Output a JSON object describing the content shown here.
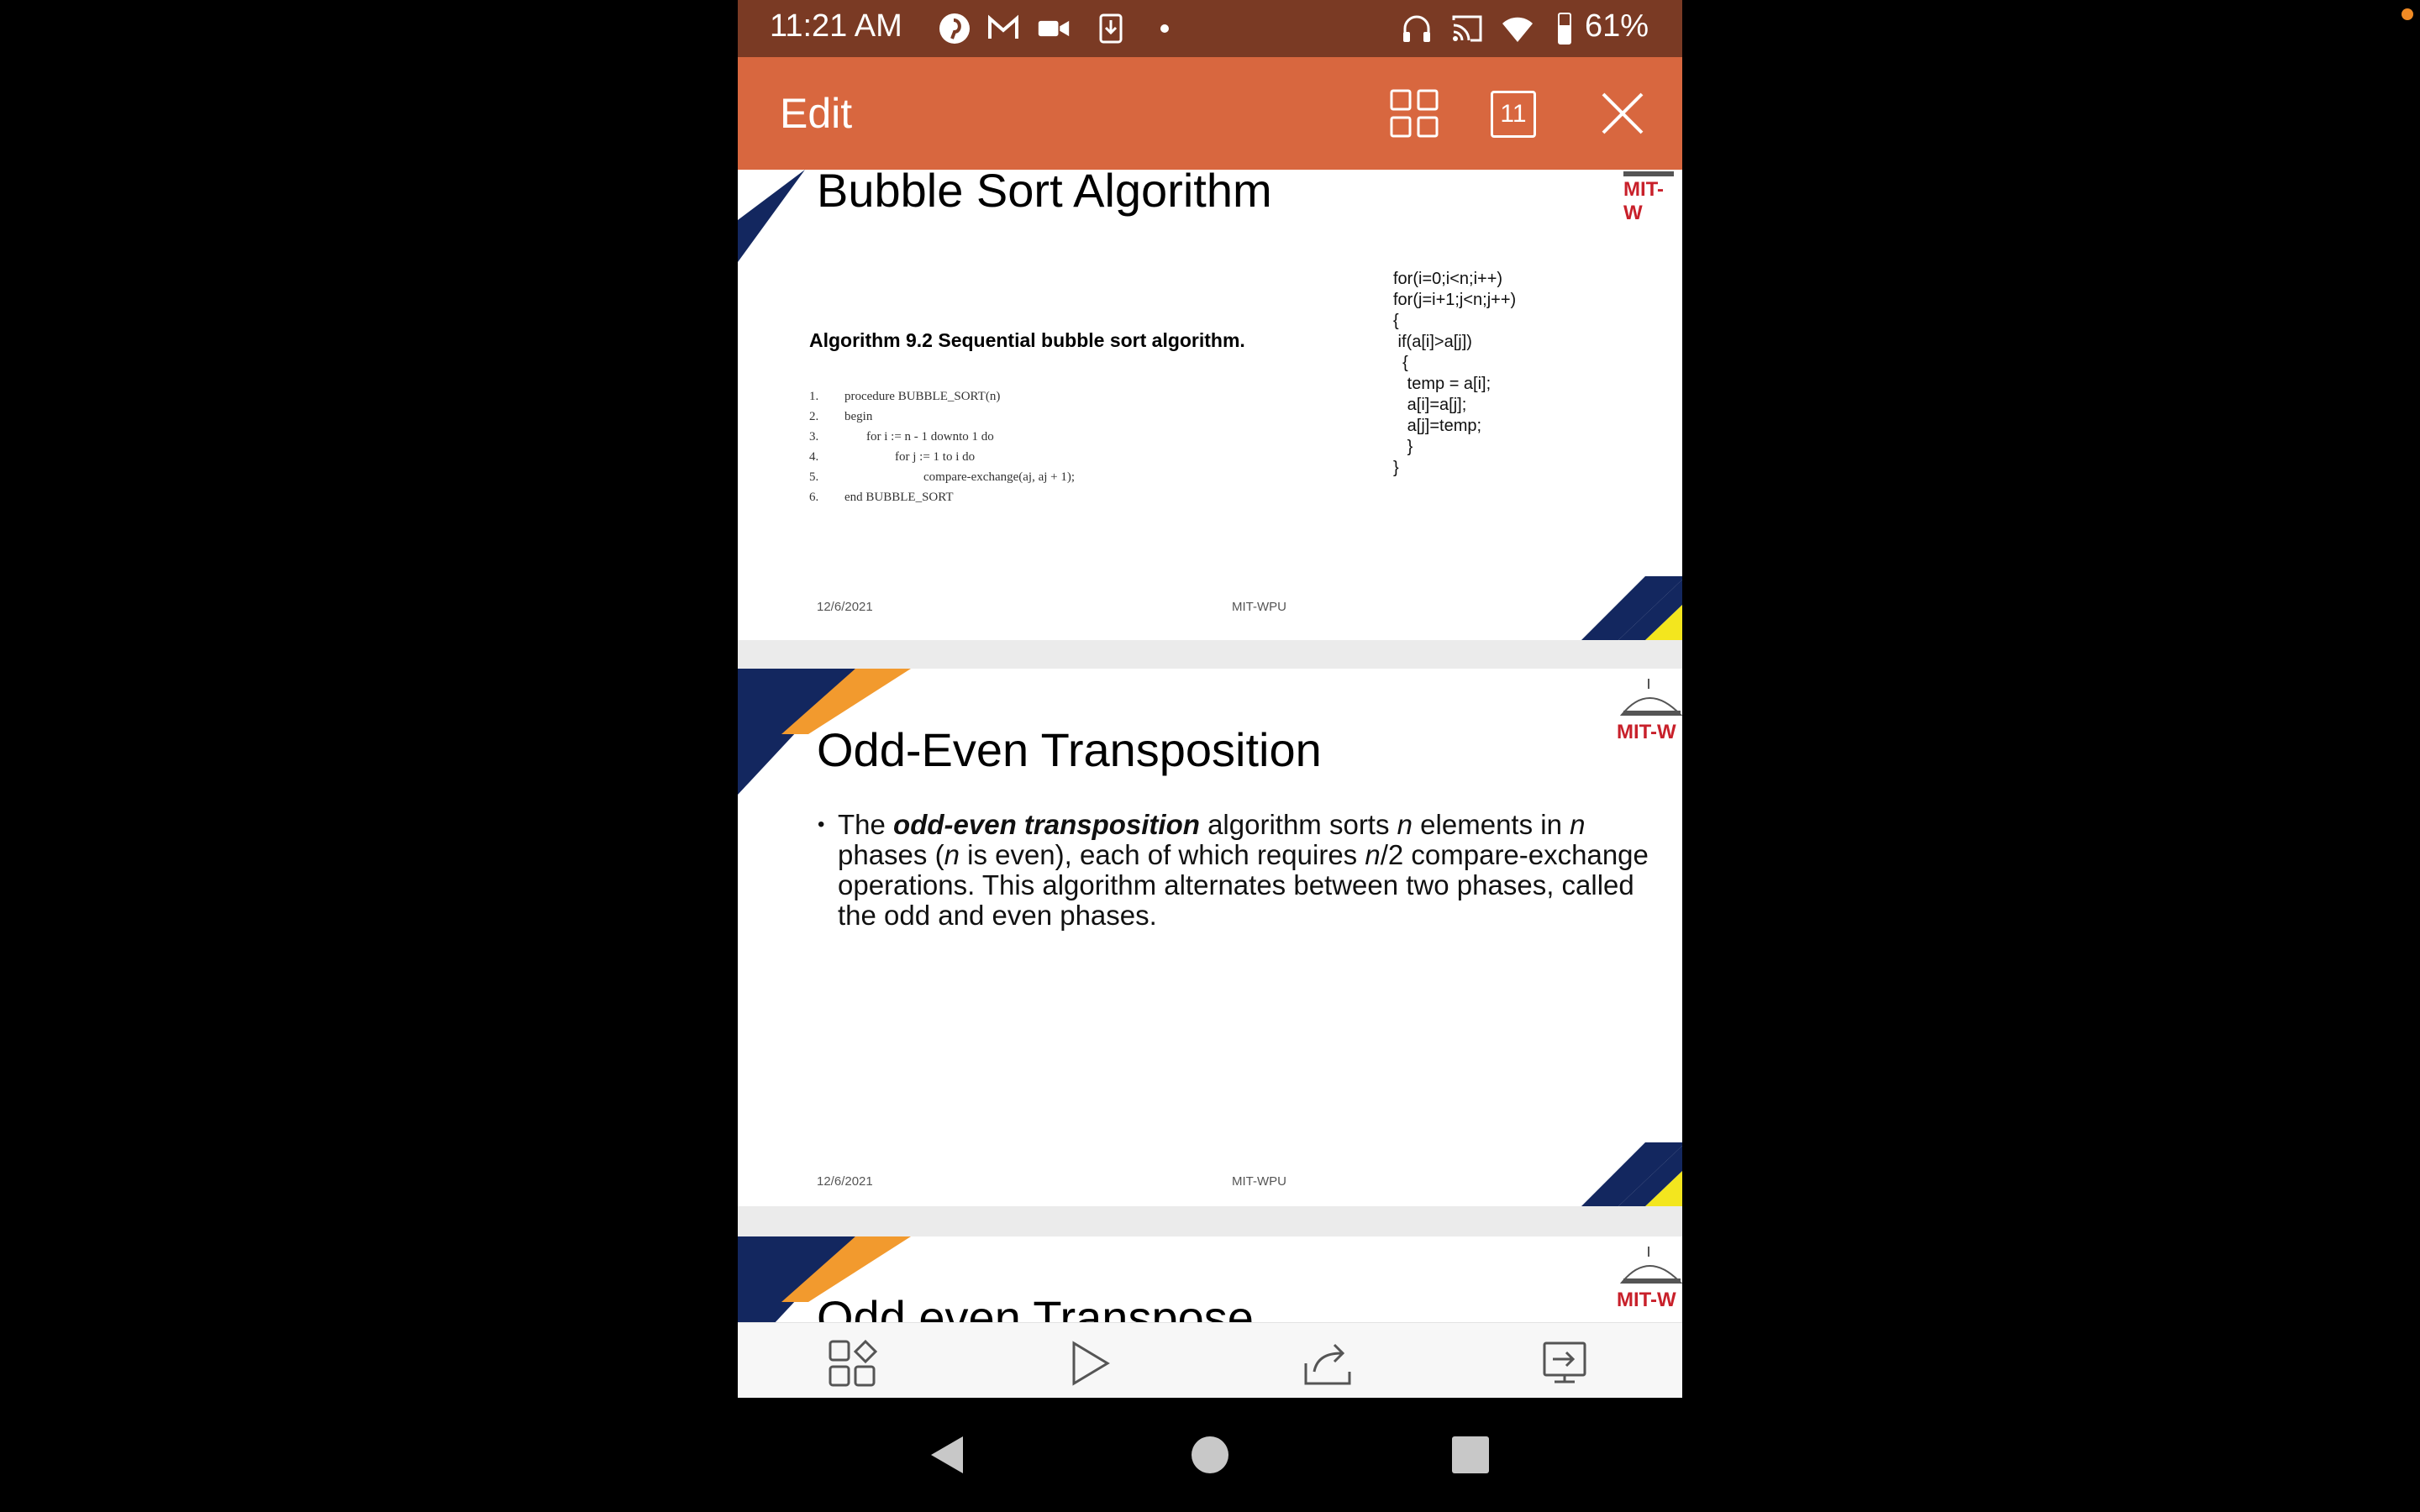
{
  "status_bar": {
    "time": "11:21 AM",
    "battery": "61%",
    "icons": [
      "pinterest-icon",
      "gmail-icon",
      "video-camera-icon",
      "download-icon",
      "dot-icon",
      "headphones-icon",
      "cast-icon",
      "wifi-icon",
      "battery-icon"
    ]
  },
  "app_bar": {
    "edit_label": "Edit",
    "page_count": "11",
    "buttons": [
      "grid-view-icon",
      "page-number-icon",
      "close-icon"
    ]
  },
  "slides": [
    {
      "title": "Bubble Sort  Algorithm",
      "algorithm_heading": "Algorithm 9.2 Sequential bubble sort algorithm.",
      "algorithm_lines": [
        {
          "num": "1.",
          "text": "procedure BUBBLE_SORT(n)"
        },
        {
          "num": "2.",
          "text": "begin"
        },
        {
          "num": "3.",
          "text": "for i := n - 1 downto 1 do"
        },
        {
          "num": "4.",
          "text": "for j := 1 to i do"
        },
        {
          "num": "5.",
          "text": "compare-exchange(aj, aj + 1);"
        },
        {
          "num": "6.",
          "text": "end BUBBLE_SORT"
        }
      ],
      "code_lines": [
        "for(i=0;i<n;i++)",
        "for(j=i+1;j<n;j++)",
        "{",
        " if(a[i]>a[j])",
        "  {",
        "   temp = a[i];",
        "   a[i]=a[j];",
        "   a[j]=temp;",
        "   }",
        "}"
      ],
      "footer_date": "12/6/2021",
      "footer_center": "MIT-WPU",
      "logo_text": "MIT-W"
    },
    {
      "title": "Odd-Even Transposition",
      "bullet": {
        "pre": "The ",
        "em": "odd-even transposition",
        "mid1": " algorithm sorts ",
        "n1": "n",
        "mid2": " elements in ",
        "n2": "n",
        "mid3": " phases (",
        "n3": "n",
        "mid4": " is even), each of which requires ",
        "n4": "n",
        "post": "/2 compare-exchange operations. This algorithm alternates between two phases, called the odd and even phases."
      },
      "footer_date": "12/6/2021",
      "footer_center": "MIT-WPU",
      "logo_text": "MIT-W"
    },
    {
      "title": "Odd even Transpose",
      "logo_text": "MIT-W"
    }
  ],
  "bottom_bar": [
    "slides-layout-icon",
    "play-icon",
    "share-icon",
    "present-icon"
  ],
  "nav_bar": [
    "back-icon",
    "home-icon",
    "recents-icon"
  ],
  "colors": {
    "status_bar": "#7a3a24",
    "app_bar": "#d8673f",
    "slide_navy": "#13275f",
    "slide_orange": "#f29a2e",
    "slide_yellow": "#f3e61e",
    "logo_red": "#c8202a"
  }
}
